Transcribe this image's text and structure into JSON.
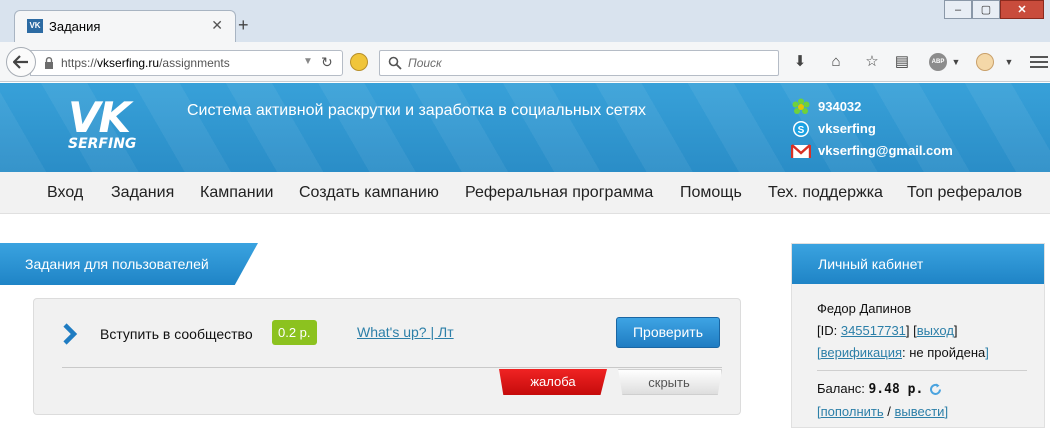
{
  "browser": {
    "tab_title": "Задания",
    "tab_favicon_text": "VK",
    "url_prefix": "https://",
    "url_host": "vkserfing.ru",
    "url_path": "/assignments",
    "search_placeholder": "Поиск",
    "adblock_label": "ABP"
  },
  "header": {
    "logo_main": "VK",
    "logo_sub": "SERFING",
    "tagline": "Система активной раскрутки и заработка в социальных сетях",
    "contacts": {
      "icq": "934032",
      "skype": "vkserfing",
      "email": "vkserfing@gmail.com"
    }
  },
  "menu": {
    "items": [
      "Вход",
      "Задания",
      "Кампании",
      "Создать кампанию",
      "Реферальная программа",
      "Помощь",
      "Тех. поддержка",
      "Топ рефералов"
    ]
  },
  "main": {
    "section_title": "Задания для пользователей",
    "task": {
      "name": "Вступить в сообщество",
      "price": "0.2 р.",
      "group_link": "What's up? | Лт",
      "check_label": "Проверить",
      "complain_label": "жалоба",
      "hide_label": "скрыть"
    }
  },
  "sidebar": {
    "title": "Личный кабинет",
    "user_name": "Федор Дапинов",
    "id_prefix": "[ID: ",
    "user_id": "345517731",
    "id_sep": "] [",
    "logout": "выход",
    "close_br": "]",
    "open_br": "[",
    "verification_link": "верификация",
    "verification_status": ": не пройдена",
    "balance_label": "Баланс: ",
    "balance_value": "9.48 р.",
    "topup": "пополнить",
    "slash": " / ",
    "withdraw": "вывести"
  },
  "colors": {
    "brand_blue": "#2a8dc7",
    "price_green": "#8cc21f",
    "complain_red": "#e01919",
    "link_blue": "#2c7fa8"
  }
}
